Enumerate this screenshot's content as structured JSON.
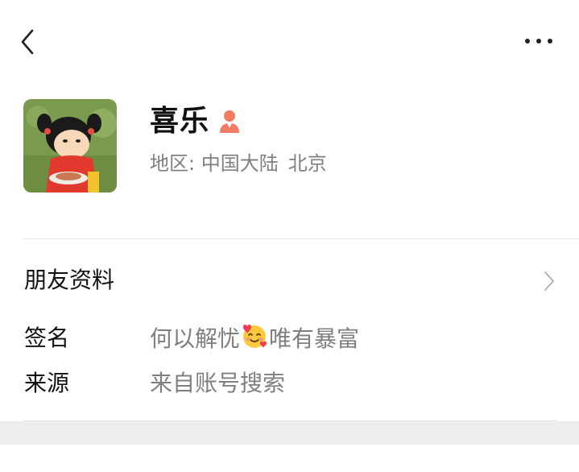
{
  "header": {
    "back_icon": "chevron-left-icon",
    "more_icon": "more-dots-icon"
  },
  "profile": {
    "name": "喜乐",
    "gender_icon": "female-icon",
    "gender_color": "#f37b63",
    "region_label": "地区:",
    "region_country": "中国大陆",
    "region_city": "北京"
  },
  "friend_info": {
    "label": "朋友资料"
  },
  "signature": {
    "label": "签名",
    "value_before": "何以解忧",
    "value_after": "唯有暴富"
  },
  "source": {
    "label": "来源",
    "value": "来自账号搜索"
  }
}
